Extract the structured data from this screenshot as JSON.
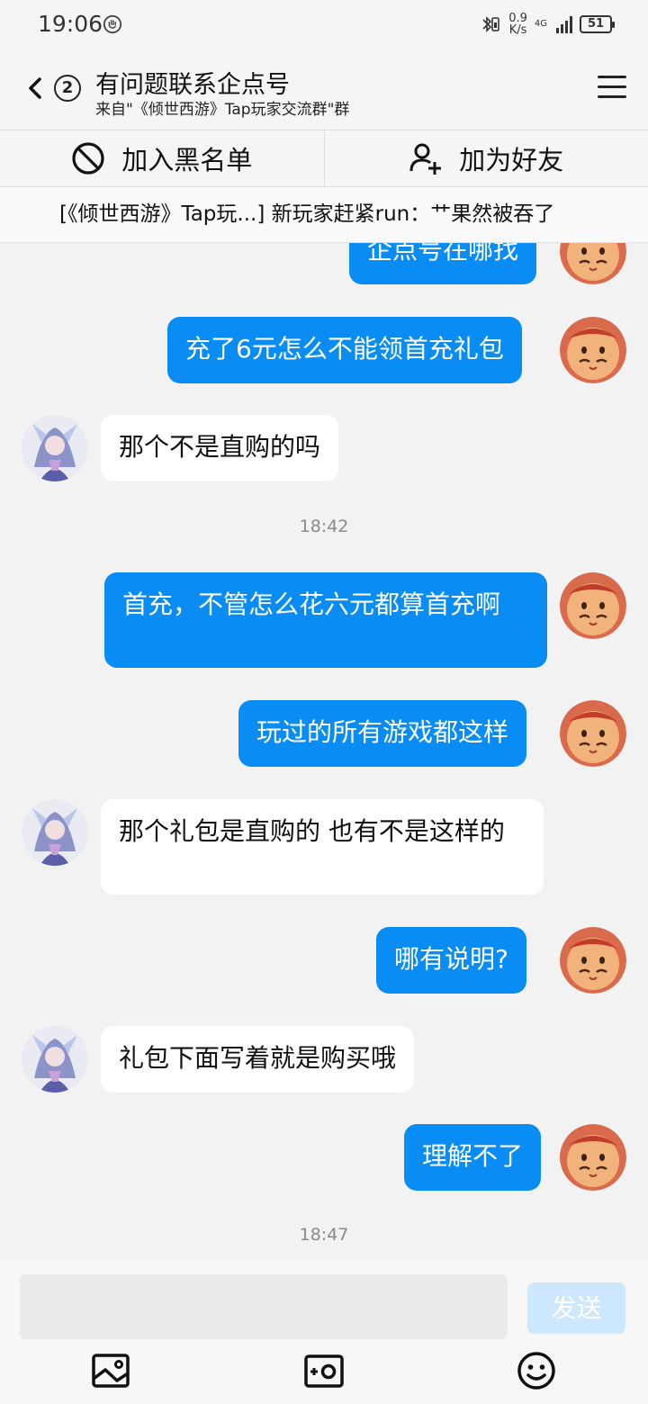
{
  "status_bar": {
    "time": "19:06",
    "speed_value": "0.9",
    "speed_unit": "K/s",
    "network": "4G",
    "battery": "51"
  },
  "header": {
    "unread_count": "2",
    "title": "有问题联系企点号",
    "subtitle": "来自\"《倾世西游》Tap玩家交流群\"群"
  },
  "actions": {
    "blacklist_label": "加入黑名单",
    "add_friend_label": "加为好友"
  },
  "notice": "[《倾世西游》Tap玩...] 新玩家赶紧run：艹果然被吞了",
  "messages": [
    {
      "from": "me",
      "text": "企点号在哪找"
    },
    {
      "from": "me",
      "text": "充了6元怎么不能领首充礼包"
    },
    {
      "from": "other",
      "text": "那个不是直购的吗"
    },
    {
      "time": "18:42"
    },
    {
      "from": "me",
      "text": "首充，不管怎么花六元都算首充啊"
    },
    {
      "from": "me",
      "text": "玩过的所有游戏都这样"
    },
    {
      "from": "other",
      "text": "那个礼包是直购的 也有不是这样的"
    },
    {
      "from": "me",
      "text": "哪有说明?"
    },
    {
      "from": "other",
      "text": "礼包下面写着就是购买哦"
    },
    {
      "from": "me",
      "text": "理解不了"
    },
    {
      "time": "18:47"
    }
  ],
  "composer": {
    "input_value": "",
    "send_label": "发送"
  },
  "icons": {
    "back": "chevron-left-icon",
    "menu": "hamburger-menu-icon",
    "blacklist": "block-icon",
    "add_friend": "add-user-icon",
    "image": "image-icon",
    "camera": "camera-icon",
    "emoji": "emoji-icon"
  },
  "colors": {
    "my_bubble": "#0a8cf5",
    "other_bubble": "#ffffff",
    "background": "#f2f2f2",
    "send_disabled": "#cde8fd"
  }
}
